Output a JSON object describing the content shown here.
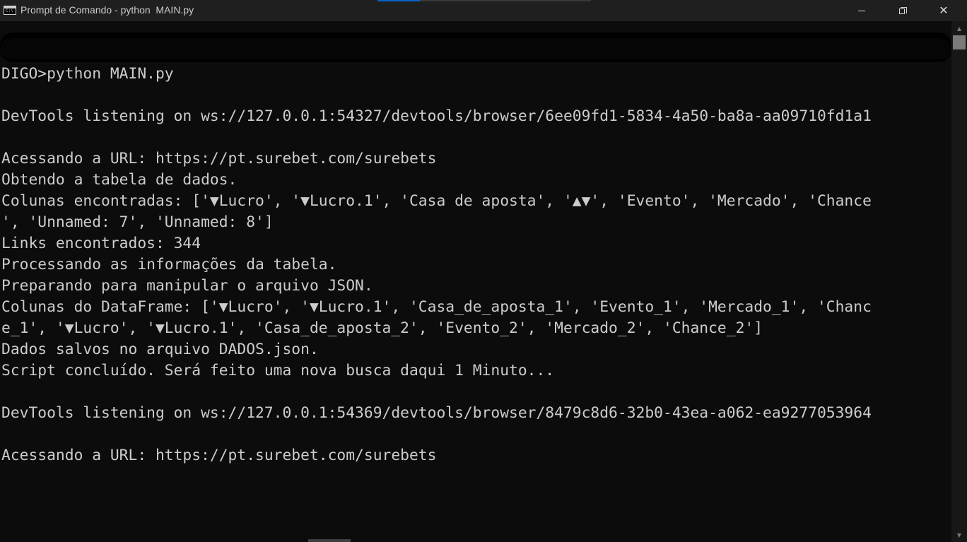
{
  "window": {
    "title": "Prompt de Comando - python  MAIN.py",
    "icon": "cmd-icon",
    "icon_text": "C:\\"
  },
  "controls": {
    "minimize_icon": "minimize-icon",
    "maximize_icon": "restore-icon",
    "close_icon": "close-icon",
    "close_glyph": "✕"
  },
  "scrollbar": {
    "up_glyph": "▲",
    "down_glyph": "▼"
  },
  "console": {
    "lines": [
      "DIGO>python MAIN.py",
      "",
      "DevTools listening on ws://127.0.0.1:54327/devtools/browser/6ee09fd1-5834-4a50-ba8a-aa09710fd1a1",
      "",
      "Acessando a URL: https://pt.surebet.com/surebets",
      "Obtendo a tabela de dados.",
      "Colunas encontradas: ['▼Lucro', '▼Lucro.1', 'Casa de aposta', '▲▼', 'Evento', 'Mercado', 'Chance",
      "', 'Unnamed: 7', 'Unnamed: 8']",
      "Links encontrados: 344",
      "Processando as informações da tabela.",
      "Preparando para manipular o arquivo JSON.",
      "Colunas do DataFrame: ['▼Lucro', '▼Lucro.1', 'Casa_de_aposta_1', 'Evento_1', 'Mercado_1', 'Chanc",
      "e_1', '▼Lucro', '▼Lucro.1', 'Casa_de_aposta_2', 'Evento_2', 'Mercado_2', 'Chance_2']",
      "Dados salvos no arquivo DADOS.json.",
      "Script concluído. Será feito uma nova busca daqui 1 Minuto...",
      "",
      "DevTools listening on ws://127.0.0.1:54369/devtools/browser/8479c8d6-32b0-43ea-a062-ea9277053964",
      "",
      "Acessando a URL: https://pt.surebet.com/surebets"
    ]
  }
}
